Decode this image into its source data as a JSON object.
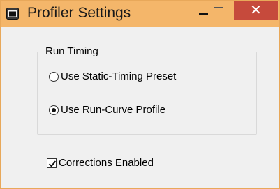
{
  "window": {
    "title": "Profiler Settings",
    "app_icon": "app-window-icon",
    "controls": {
      "minimize_icon": "minimize-icon",
      "maximize_icon": "maximize-icon",
      "close_glyph": "✕",
      "close_color": "#c64a3c"
    },
    "titlebar_color": "#f4b66a"
  },
  "run_timing": {
    "label": "Run Timing",
    "options": [
      {
        "label": "Use Static-Timing Preset",
        "selected": false
      },
      {
        "label": "Use Run-Curve Profile",
        "selected": true
      }
    ]
  },
  "corrections": {
    "label": "Corrections Enabled",
    "checked": true
  }
}
